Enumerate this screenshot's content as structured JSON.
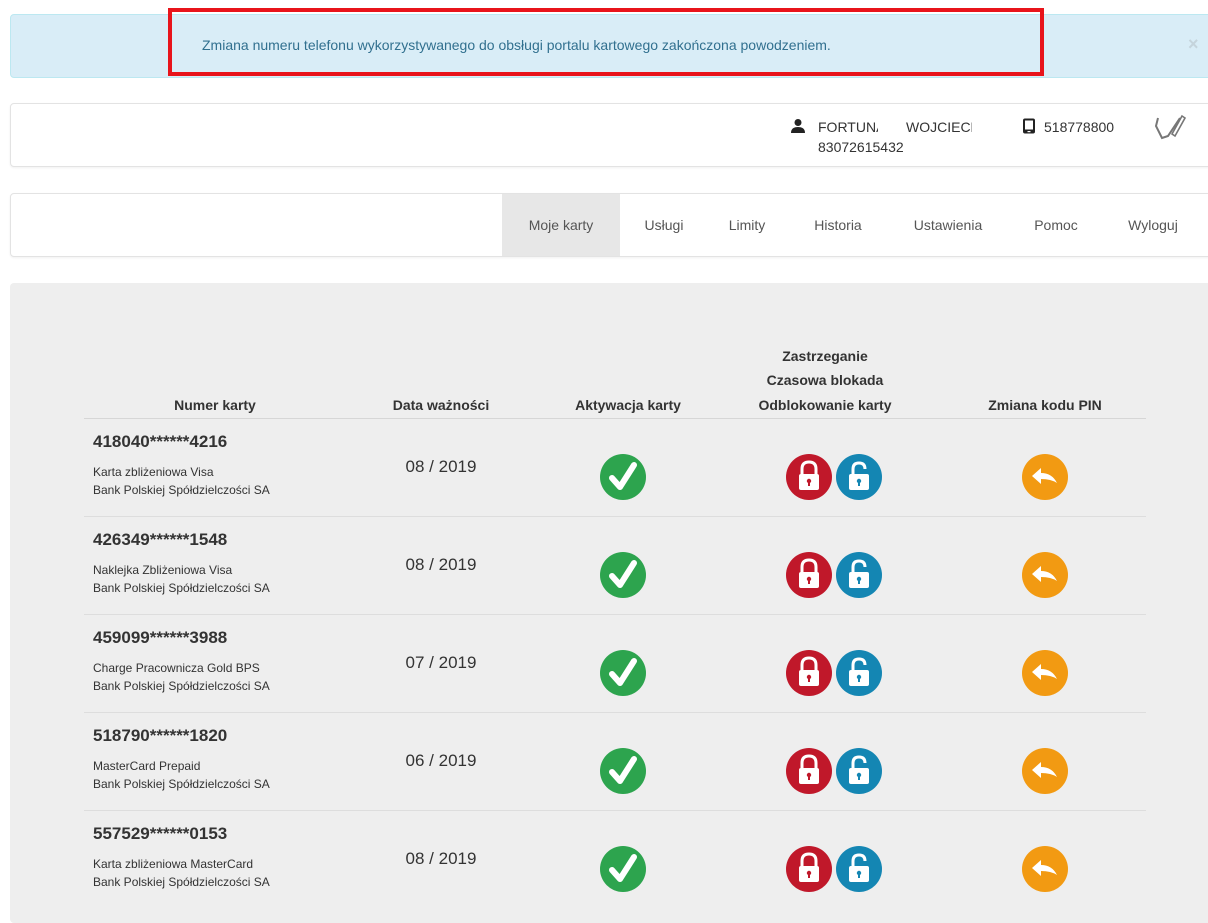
{
  "alert": {
    "message": "Zmiana numeru telefonu wykorzystywanego do obsługi portalu kartowego zakończona powodzeniem.",
    "close": "×"
  },
  "user": {
    "name_first": "FORTUNA",
    "name_second": "WOJCIECH",
    "id": "83072615432",
    "phone": "518778800",
    "icons": [
      "user-icon",
      "phone-icon",
      "edit-icon"
    ]
  },
  "nav": {
    "items": [
      "Moje karty",
      "Usługi",
      "Limity",
      "Historia",
      "Ustawienia",
      "Pomoc",
      "Wyloguj"
    ],
    "active": "Moje karty"
  },
  "table": {
    "headers": {
      "card_number": "Numer karty",
      "expiry": "Data ważności",
      "activation": "Aktywacja karty",
      "block_line1": "Zastrzeganie",
      "block_line2": "Czasowa blokada",
      "block_line3": "Odblokowanie karty",
      "pin": "Zmiana kodu PIN"
    },
    "rows": [
      {
        "number": "418040******4216",
        "type": "Karta zbliżeniowa Visa",
        "bank": "Bank Polskiej Spółdzielczości SA",
        "expiry": "08 / 2019"
      },
      {
        "number": "426349******1548",
        "type": "Naklejka Zbliżeniowa Visa",
        "bank": "Bank Polskiej Spółdzielczości SA",
        "expiry": "08 / 2019"
      },
      {
        "number": "459099******3988",
        "type": "Charge Pracownicza Gold BPS",
        "bank": "Bank Polskiej Spółdzielczości SA",
        "expiry": "07 / 2019"
      },
      {
        "number": "518790******1820",
        "type": "MasterCard Prepaid",
        "bank": "Bank Polskiej Spółdzielczości SA",
        "expiry": "06 / 2019"
      },
      {
        "number": "557529******0153",
        "type": "Karta zbliżeniowa MasterCard",
        "bank": "Bank Polskiej Spółdzielczości SA",
        "expiry": "08 / 2019"
      }
    ]
  },
  "colors": {
    "alert_bg": "#d9edf7",
    "alert_text": "#31708f",
    "highlight": "#e8141b",
    "check_green": "#2da44e",
    "lock_red": "#c0182a",
    "unlock_blue": "#1486b3",
    "pin_orange": "#f29a12"
  }
}
